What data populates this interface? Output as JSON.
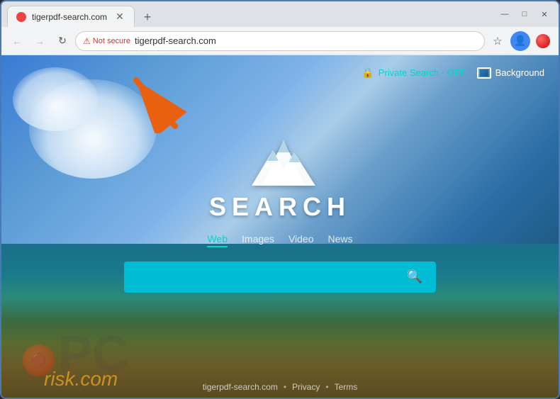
{
  "browser": {
    "tab": {
      "title": "tigerpdf-search.com",
      "favicon": "red-circle"
    },
    "new_tab_label": "+",
    "window_controls": {
      "minimize": "—",
      "maximize": "□",
      "close": "✕"
    },
    "nav": {
      "back": "←",
      "forward": "→",
      "reload": "↻",
      "security_label": "Not secure",
      "url": "tigerpdf-search.com",
      "bookmark_icon": "☆",
      "profile_icon": "👤",
      "extension_icon": "🔴"
    }
  },
  "page": {
    "top_right": {
      "private_search_label": "Private Search - OFF",
      "background_label": "Background"
    },
    "logo": {
      "text": "SEARCH"
    },
    "search_tabs": [
      {
        "label": "Web",
        "active": true
      },
      {
        "label": "Images",
        "active": false
      },
      {
        "label": "Video",
        "active": false
      },
      {
        "label": "News",
        "active": false
      }
    ],
    "search_placeholder": "",
    "footer": {
      "items": [
        {
          "text": "tigerpdf-search.com"
        },
        {
          "text": "Privacy"
        },
        {
          "text": "Terms"
        }
      ],
      "separator": "•"
    }
  },
  "annotation": {
    "arrow_color": "#e86010"
  }
}
